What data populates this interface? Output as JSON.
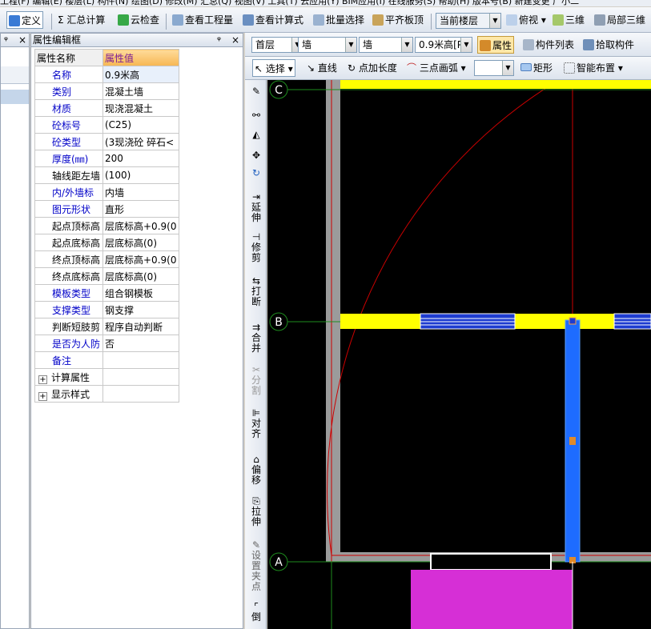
{
  "menubar": {
    "text": "工程(F)  编辑(E)  楼层(L)  构件(N)  绘图(D)  修改(M)  汇总(Q)  视图(V)  工具(T)  云应用(Y)  BIM应用(I)  在线服务(S)  帮助(H)  版本号(B)  新建变更  广小二"
  },
  "toolbar1": {
    "define": "定义",
    "sum_calc": "汇总计算",
    "cloud_check": "云检查",
    "view_quantity": "查看工程量",
    "view_formula": "查看计算式",
    "batch_select": "批量选择",
    "align_slab_top": "平齐板顶",
    "current_floor": "当前楼层",
    "top_view": "俯视",
    "threed": "三维",
    "local_3d": "局部三维"
  },
  "toolbar2": {
    "floor": "首层",
    "type1": "墙",
    "type2": "墙",
    "component": "0.9米高[P",
    "properties": "属性",
    "component_list": "构件列表",
    "pick_component": "拾取构件"
  },
  "toolbar3": {
    "select": "选择",
    "line": "直线",
    "point_length": "点加长度",
    "three_point_arc": "三点画弧",
    "rect": "矩形",
    "smart_place": "智能布置"
  },
  "vertical_toolbar": {
    "extend": "延伸",
    "trim": "修剪",
    "break": "打断",
    "merge": "合并",
    "split": "分割",
    "align": "对齐",
    "offset": "偏移",
    "stretch": "拉伸",
    "set_grip": "设置夹点",
    "last": "倒"
  },
  "property_panel": {
    "title": "属性编辑框",
    "pin": "ᵠ",
    "close": "×",
    "header_name": "属性名称",
    "header_value": "属性值",
    "rows": [
      {
        "name": "名称",
        "value": "0.9米高",
        "blue": true
      },
      {
        "name": "类别",
        "value": "混凝土墙",
        "blue": true
      },
      {
        "name": "材质",
        "value": "现浇混凝土",
        "blue": true
      },
      {
        "name": "砼标号",
        "value": "(C25)",
        "blue": true
      },
      {
        "name": "砼类型",
        "value": "(3现浇砼 碎石<",
        "blue": true
      },
      {
        "name": "厚度(㎜)",
        "value": "200",
        "blue": true
      },
      {
        "name": "轴线距左墙",
        "value": "(100)",
        "blue": false
      },
      {
        "name": "内/外墙标",
        "value": "内墙",
        "blue": true
      },
      {
        "name": "图元形状",
        "value": "直形",
        "blue": true
      },
      {
        "name": "起点顶标高",
        "value": "层底标高+0.9(0",
        "blue": false
      },
      {
        "name": "起点底标高",
        "value": "层底标高(0)",
        "blue": false
      },
      {
        "name": "终点顶标高",
        "value": "层底标高+0.9(0",
        "blue": false
      },
      {
        "name": "终点底标高",
        "value": "层底标高(0)",
        "blue": false
      },
      {
        "name": "模板类型",
        "value": "组合钢模板",
        "blue": true
      },
      {
        "name": "支撑类型",
        "value": "钢支撑",
        "blue": true
      },
      {
        "name": "判断短肢剪",
        "value": "程序自动判断",
        "blue": false
      },
      {
        "name": "是否为人防",
        "value": "否",
        "blue": true
      },
      {
        "name": "备注",
        "value": "",
        "blue": true
      }
    ],
    "expand_rows": [
      "计算属性",
      "显示样式"
    ]
  },
  "left_panel": {
    "pin": "ᵠ",
    "close": "×"
  },
  "canvas": {
    "axis_labels": [
      "C",
      "B",
      "A"
    ],
    "colors": {
      "background": "#000000",
      "wall_yellow": "#ffff00",
      "wall_blue": "#1e6cff",
      "slab_magenta": "#d62fd6",
      "grey_wall": "#9b9b9b",
      "grid_red": "#cc0000",
      "grid_green": "#1e8c1e"
    }
  }
}
